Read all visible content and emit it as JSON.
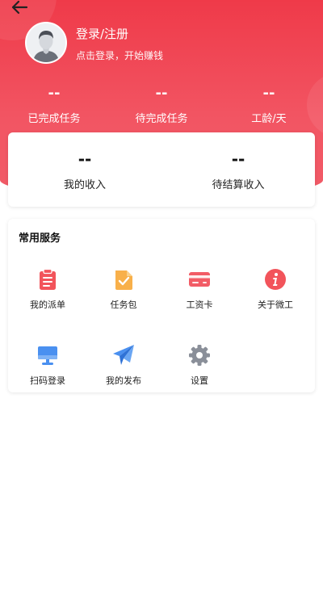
{
  "header": {
    "login_title": "登录/注册",
    "login_subtitle": "点击登录，开始赚钱"
  },
  "stats": [
    {
      "value": "--",
      "label": "已完成任务"
    },
    {
      "value": "--",
      "label": "待完成任务"
    },
    {
      "value": "--",
      "label": "工龄/天"
    }
  ],
  "income": [
    {
      "value": "--",
      "label": "我的收入"
    },
    {
      "value": "--",
      "label": "待结算收入"
    }
  ],
  "services": {
    "title": "常用服务",
    "items": [
      {
        "label": "我的派单",
        "icon": "clipboard-icon"
      },
      {
        "label": "任务包",
        "icon": "task-package-icon"
      },
      {
        "label": "工资卡",
        "icon": "bank-card-icon"
      },
      {
        "label": "关于微工",
        "icon": "info-icon"
      },
      {
        "label": "扫码登录",
        "icon": "monitor-icon"
      },
      {
        "label": "我的发布",
        "icon": "paper-plane-icon"
      },
      {
        "label": "设置",
        "icon": "gear-icon"
      }
    ]
  },
  "colors": {
    "brand_red": "#ef3a49",
    "icon_red": "#f2545b",
    "icon_orange": "#f8b04a",
    "icon_blue": "#4a90f0",
    "icon_gray": "#8a8f99"
  }
}
